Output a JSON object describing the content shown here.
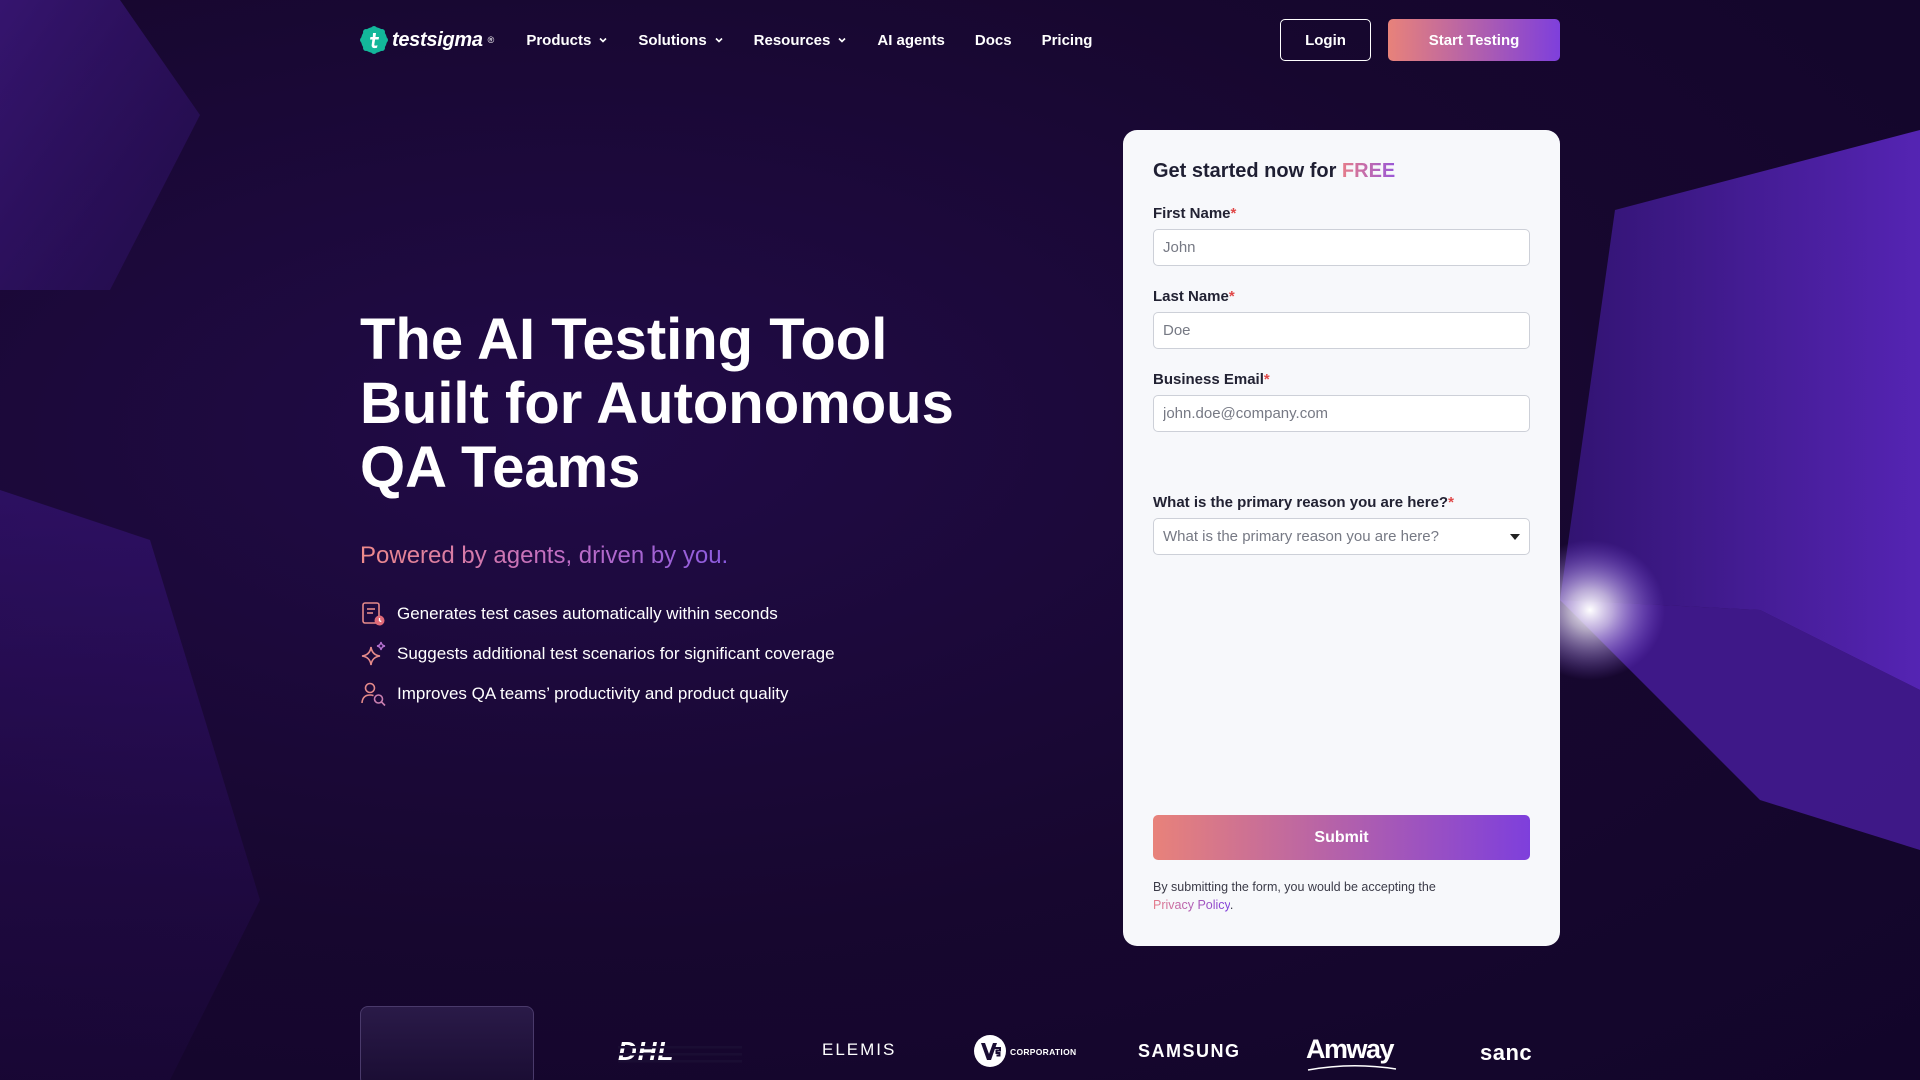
{
  "nav": {
    "brand": "testsigma",
    "brand_mark": "®",
    "items": [
      {
        "label": "Products",
        "has_dropdown": true
      },
      {
        "label": "Solutions",
        "has_dropdown": true
      },
      {
        "label": "Resources",
        "has_dropdown": true
      },
      {
        "label": "AI agents",
        "has_dropdown": false
      },
      {
        "label": "Docs",
        "has_dropdown": false
      },
      {
        "label": "Pricing",
        "has_dropdown": false
      }
    ],
    "login_label": "Login",
    "start_label": "Start Testing"
  },
  "hero": {
    "title": "The AI Testing Tool\nBuilt for Autonomous\nQA Teams",
    "tagline": "Powered by agents, driven by you.",
    "features": [
      {
        "icon": "document-clock-icon",
        "text": "Generates test cases automatically within seconds"
      },
      {
        "icon": "sparkles-icon",
        "text": "Suggests additional test scenarios for significant coverage"
      },
      {
        "icon": "user-search-icon",
        "text": "Improves QA teams’ productivity and product quality"
      }
    ]
  },
  "form": {
    "title_prefix": "Get started now for ",
    "title_highlight": "FREE",
    "required_mark": "*",
    "first_name": {
      "label": "First Name",
      "placeholder": "John"
    },
    "last_name": {
      "label": "Last Name",
      "placeholder": "Doe"
    },
    "email": {
      "label": "Business Email",
      "placeholder": "john.doe@company.com"
    },
    "reason": {
      "label": "What is the primary reason you are here?",
      "placeholder": "What is the primary reason you are here?"
    },
    "submit_label": "Submit",
    "disclaimer": "By submitting the form, you would be accepting the",
    "privacy_label": "Privacy Policy",
    "privacy_suffix": "."
  },
  "customers": [
    "DHL",
    "ELEMIS",
    "CORPORATION",
    "SAMSUNG",
    "Amway",
    "sanc"
  ],
  "colors": {
    "accent_start": "#e8827a",
    "accent_end": "#7e3fdc",
    "background": "#1a0a3a",
    "required": "#e04848"
  }
}
